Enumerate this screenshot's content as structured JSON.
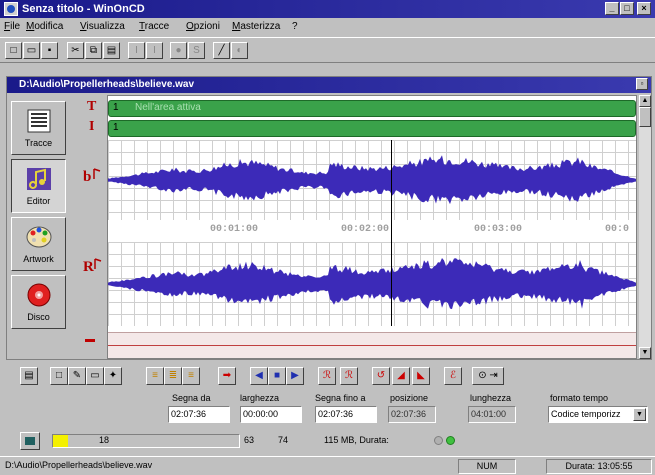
{
  "app": {
    "title": "Senza titolo - WinOnCD"
  },
  "window_buttons": [
    "_",
    "□",
    "×"
  ],
  "menu": [
    "File",
    "Modifica",
    "Visualizza",
    "Tracce",
    "Opzioni",
    "Masterizza",
    "?"
  ],
  "document": {
    "title": "D:\\Audio\\Propellerheads\\believe.wav"
  },
  "side_tabs": [
    {
      "label": "Tracce",
      "icon": "tracks-icon"
    },
    {
      "label": "Editor",
      "icon": "music-note-icon",
      "active": true
    },
    {
      "label": "Artwork",
      "icon": "palette-icon"
    },
    {
      "label": "Disco",
      "icon": "disc-icon"
    }
  ],
  "track_markers": {
    "t": "T",
    "i": "I"
  },
  "green_tracks": [
    {
      "number": "1",
      "text": "Nell'area attiva"
    },
    {
      "number": "1",
      "text": ""
    }
  ],
  "time_labels": [
    "00:01:00",
    "00:02:00",
    "00:03:00",
    "00:0"
  ],
  "fields": {
    "segna_da": {
      "label": "Segna da",
      "value": "02:07:36"
    },
    "larghezza": {
      "label": "larghezza",
      "value": "00:00:00"
    },
    "segna_fino_a": {
      "label": "Segna fino a",
      "value": "02:07:36"
    },
    "posizione": {
      "label": "posizione",
      "value": "02:07:36"
    },
    "lunghezza": {
      "label": "lunghezza",
      "value": "04:01:00"
    },
    "formato_tempo": {
      "label": "formato tempo",
      "value": "Codice temporizz"
    }
  },
  "progress": {
    "value_label": "18",
    "fill_fraction": 0.08,
    "left_num": "63",
    "right_num": "74",
    "size_text": "115 MB, Durata:"
  },
  "status": {
    "path": "D:\\Audio\\Propellerheads\\believe.wav",
    "num": "NUM",
    "duration": "Durata: 13:05:55"
  },
  "colors": {
    "waveform": "#3c2ab8",
    "track_green": "#3aa24a",
    "titlebar": "#1a1a8a",
    "progress_yellow": "#f4f000"
  }
}
